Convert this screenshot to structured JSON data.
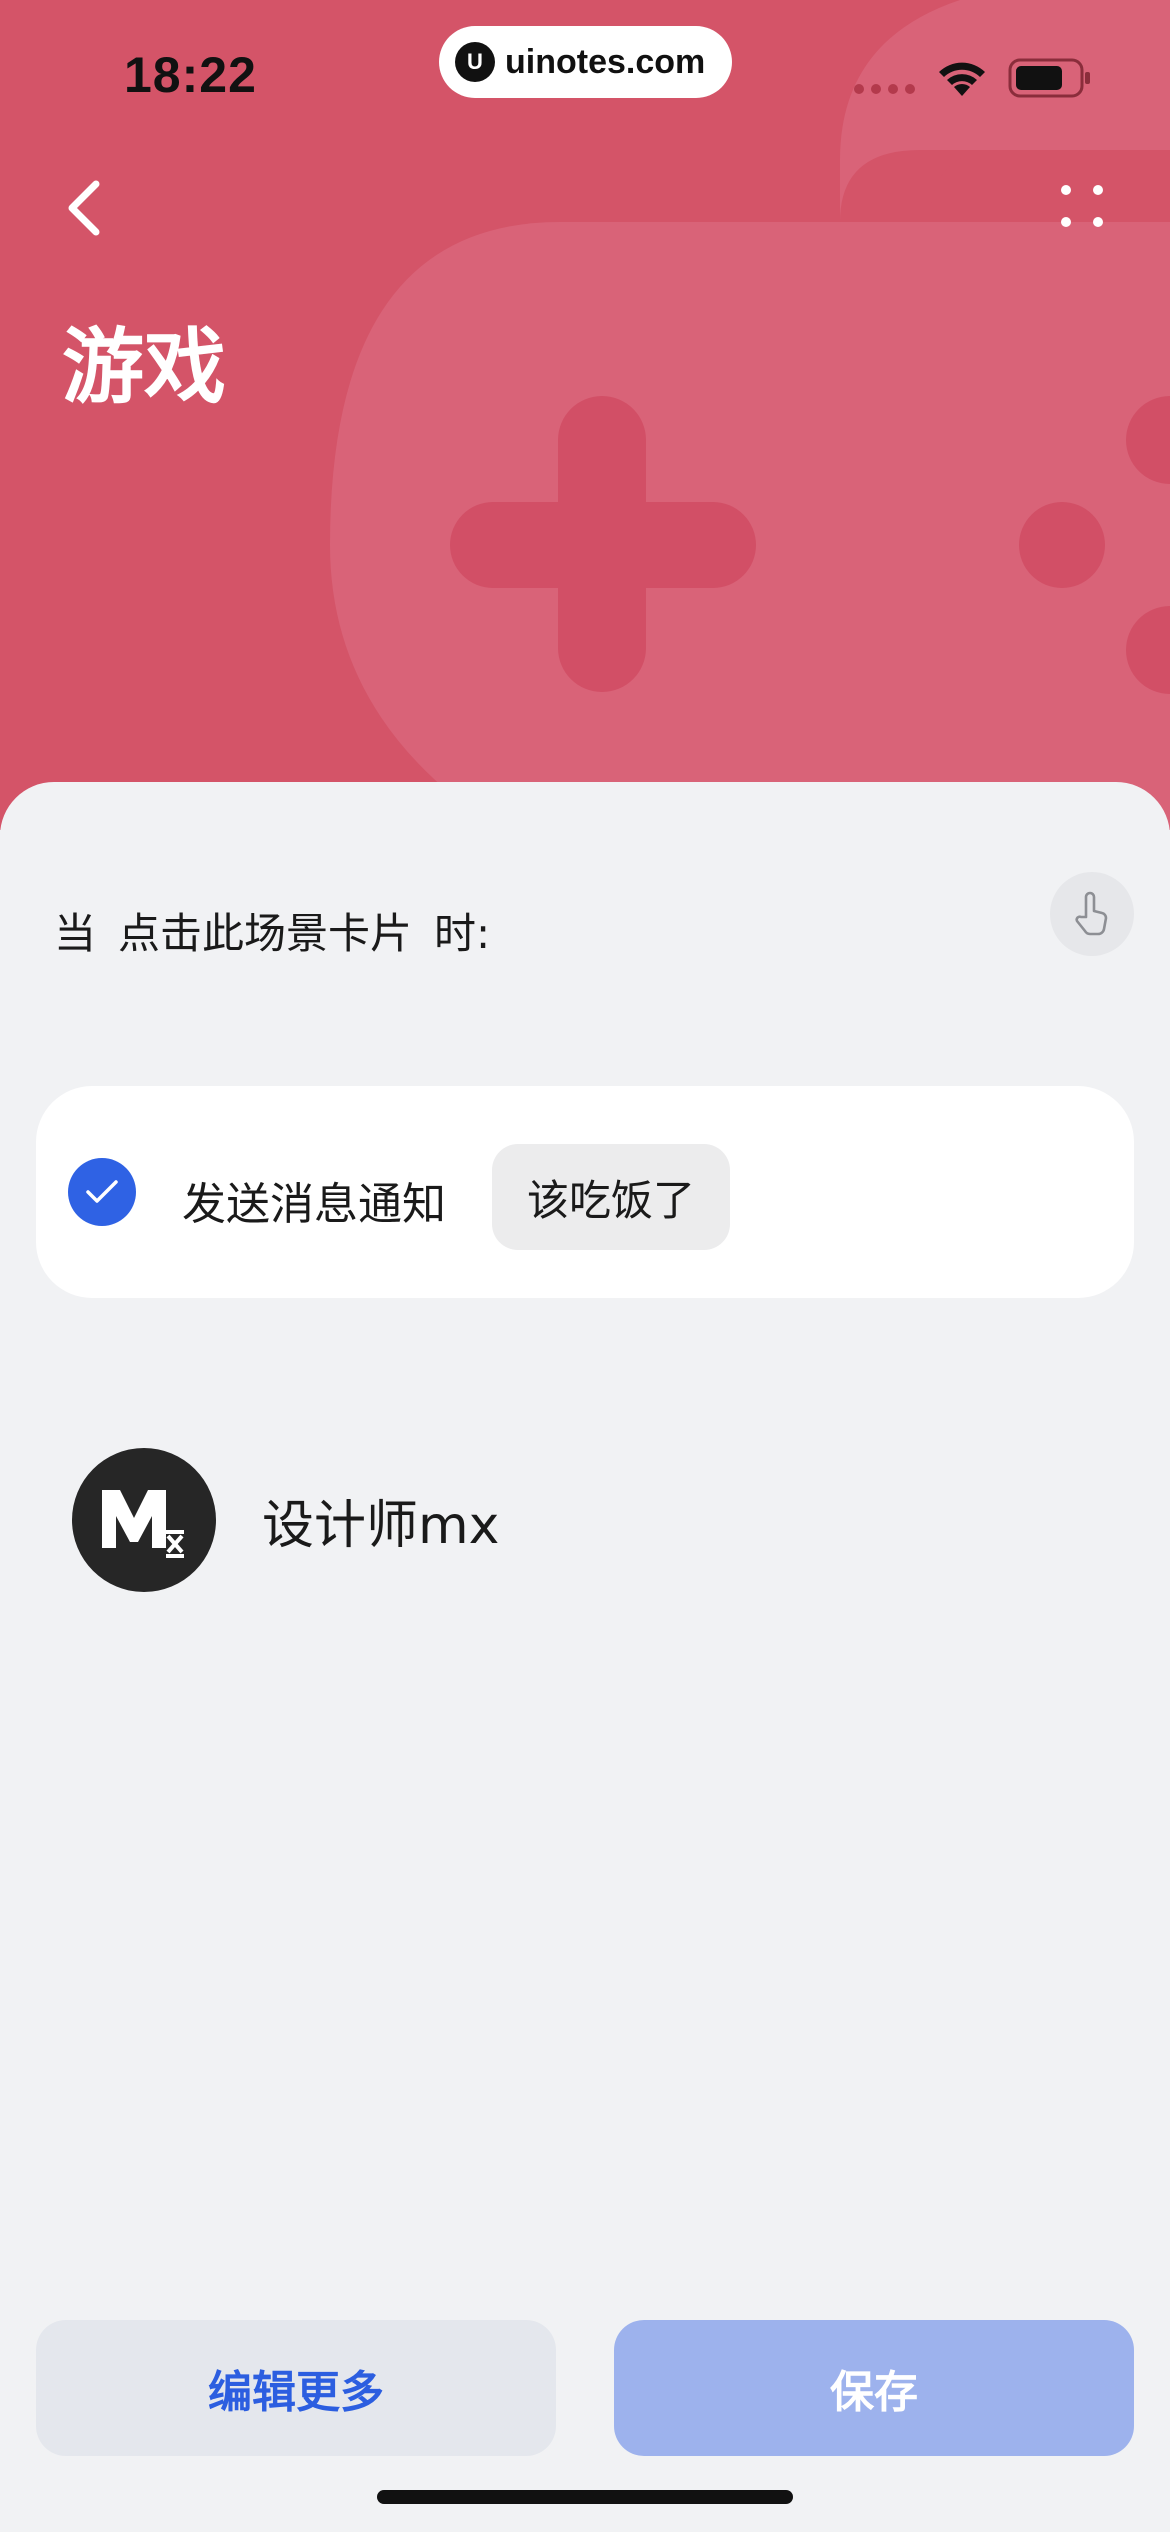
{
  "colors": {
    "header_bg": "#d45468",
    "accent_blue": "#2f62e4",
    "save_button_bg": "#9db2ed",
    "edit_button_bg": "#e4e7ed",
    "page_bg": "#f1f2f4"
  },
  "status_bar": {
    "time": "18:22",
    "watermark_logo": "U",
    "watermark": "uinotes.com",
    "icons": [
      "signal-icon",
      "wifi-icon",
      "battery-icon"
    ]
  },
  "header": {
    "back_icon": "chevron-left-icon",
    "more_icon": "more-dots-icon",
    "title": "游戏",
    "background_icon": "gamepad-icon"
  },
  "trigger": {
    "prefix": "当",
    "condition": "点击此场景卡片",
    "suffix": "时:",
    "tap_icon": "hand-tap-icon"
  },
  "action": {
    "checked": true,
    "check_icon": "check-icon",
    "label": "发送消息通知",
    "message": "该吃饭了"
  },
  "author": {
    "avatar_icon": "mx-logo-icon",
    "name": "设计师mx"
  },
  "buttons": {
    "edit_more": "编辑更多",
    "save": "保存"
  }
}
